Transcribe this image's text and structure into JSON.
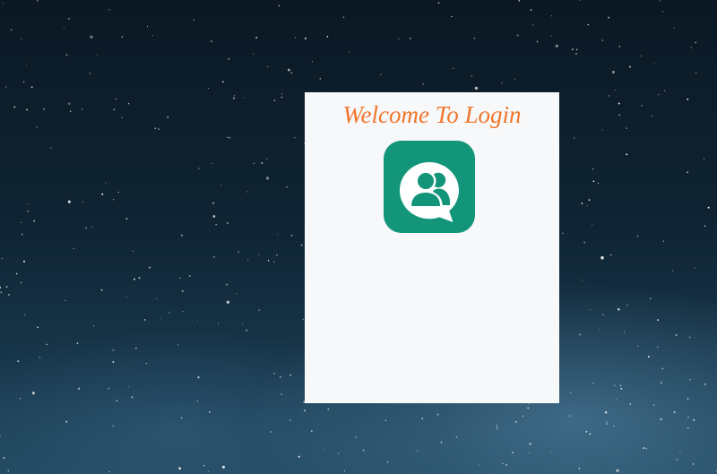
{
  "login": {
    "title": "Welcome To Login",
    "logo_icon": "users-chat-icon"
  },
  "colors": {
    "title": "#f0752a",
    "logo_bg": "#13957a",
    "panel_bg": "#f7f8f9",
    "background": "#0f2332"
  }
}
